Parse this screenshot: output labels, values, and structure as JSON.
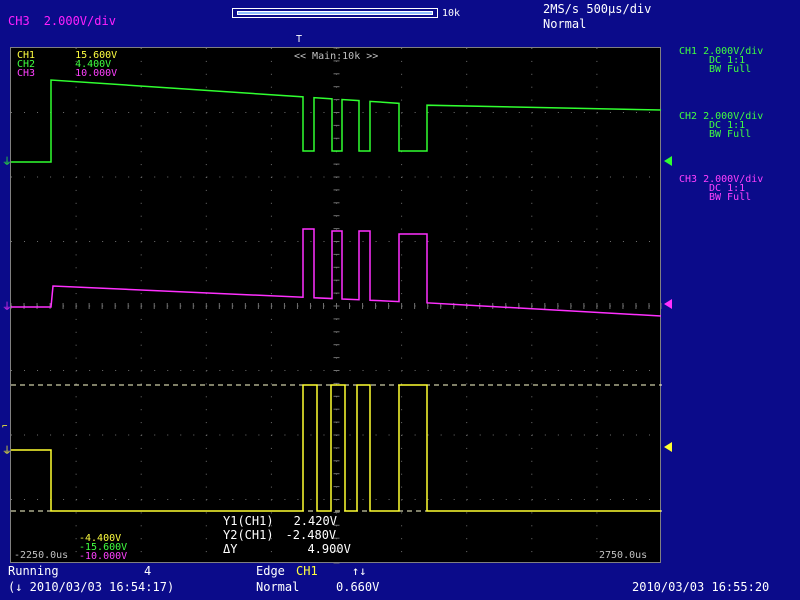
{
  "top": {
    "channel": "CH3",
    "volts_div": "2.000V/div",
    "record_length": "10k",
    "sample_rate": "2MS/s",
    "time_div": "500µs/div",
    "mode": "Normal"
  },
  "plot": {
    "trigger_marker": "T",
    "main_label": "<< Main:10k >>",
    "top_scale": [
      {
        "name": "CH1",
        "value": "15.600V",
        "color": "#ffff40"
      },
      {
        "name": "CH2",
        "value": "4.400V",
        "color": "#40ff40"
      },
      {
        "name": "CH3",
        "value": "10.000V",
        "color": "#ff40ff"
      }
    ],
    "bottom_scale": [
      {
        "value": "-4.400V",
        "color": "#ffff40"
      },
      {
        "value": "-15.600V",
        "color": "#40ff40"
      },
      {
        "value": "-10.000V",
        "color": "#ff40ff"
      }
    ],
    "time_left": "-2250.0us",
    "time_right": "2750.0us",
    "cursors": {
      "y1_label": "Y1(CH1)",
      "y1_value": "2.420V",
      "y2_label": "Y2(CH1)",
      "y2_value": "-2.480V",
      "dy_label": "ΔY",
      "dy_value": "4.900V"
    }
  },
  "channels": [
    {
      "name": "CH1",
      "volts_div": "2.000V/div",
      "coupling": "DC",
      "probe": "1:1",
      "bandwidth": "BW Full",
      "color": "#40ff40"
    },
    {
      "name": "CH2",
      "volts_div": "2.000V/div",
      "coupling": "DC",
      "probe": "1:1",
      "bandwidth": "BW Full",
      "color": "#ff40ff"
    },
    {
      "name": "CH3",
      "volts_div": "2.000V/div",
      "coupling": "DC",
      "probe": "1:1",
      "bandwidth": "BW Full",
      "color": "#ff40ff"
    }
  ],
  "status": {
    "state": "Running",
    "acq_count": "4",
    "acq_time": "(↓ 2010/03/03 16:54:17)",
    "trigger_type": "Edge",
    "trigger_source": "CH1",
    "trigger_slope": "↑↓",
    "trigger_mode": "Normal",
    "trigger_level": "0.660V",
    "clock": "2010/03/03 16:55:20"
  },
  "colors": {
    "ch1_trace": "#30ff30",
    "ch2_trace": "#ff30ff",
    "ch3_trace": "#ffff30",
    "background": "#0b0b8a",
    "grid": "#707070"
  }
}
